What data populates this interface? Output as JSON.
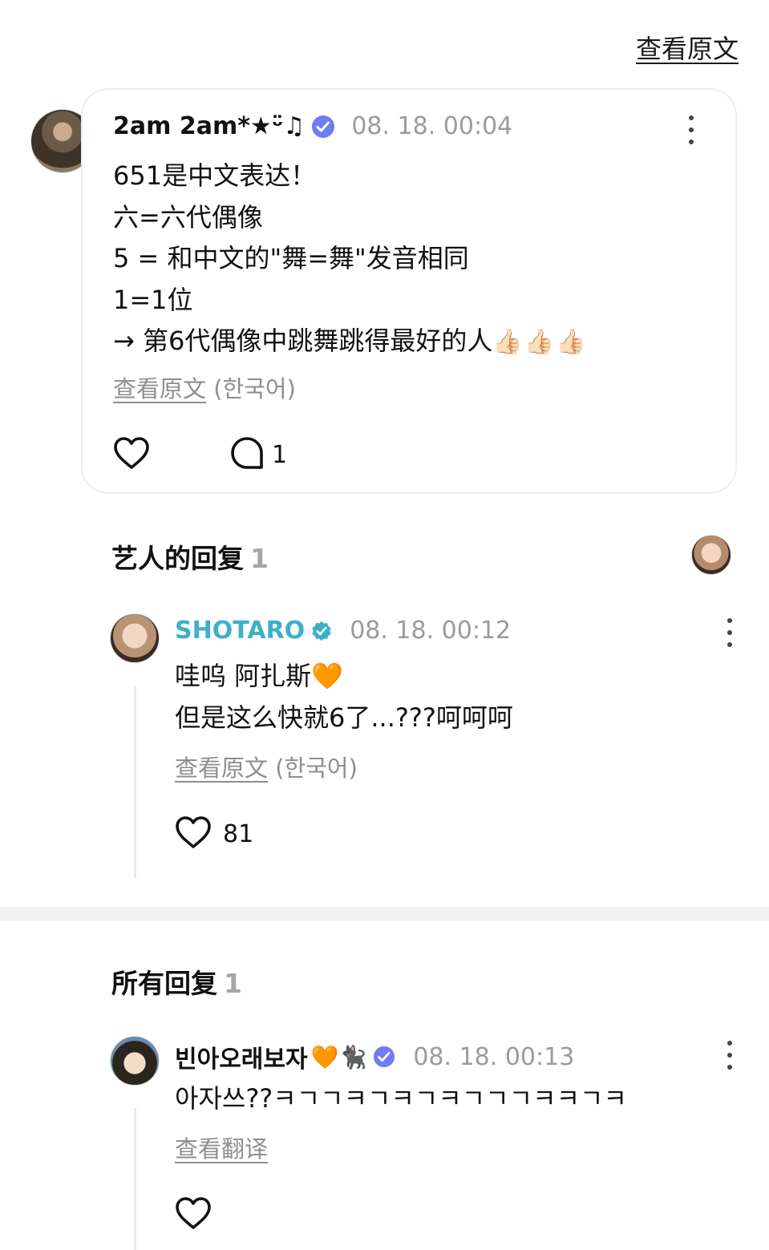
{
  "header": {
    "view_original": "查看原文"
  },
  "post": {
    "author": "2am 2am*★ᵕ̈♫",
    "timestamp": "08. 18. 00:04",
    "lines": [
      "651是中文表达！",
      "六=六代偶像",
      "5 = 和中文的\"舞=舞\"发音相同",
      "1=1位",
      "→ 第6代偶像中跳舞跳得最好的人"
    ],
    "line5_emoji": "👍🏻👍🏻👍🏻",
    "view_original_label": "查看原文",
    "original_language": "(한국어)",
    "reply_count": "1"
  },
  "artist_replies": {
    "title": "艺人的回复",
    "count": "1",
    "items": [
      {
        "author": "SHOTARO",
        "author_color": "#3db0c8",
        "timestamp": "08. 18. 00:12",
        "line1": "哇呜 阿扎斯",
        "line1_emoji": "🧡",
        "line2": "但是这么快就6了...???呵呵呵",
        "view_original_label": "查看原文",
        "original_language": "(한국어)",
        "likes": "81"
      }
    ]
  },
  "all_replies": {
    "title": "所有回复",
    "count": "1",
    "items": [
      {
        "author": "빈아오래보자",
        "author_emoji": "🧡🐈‍⬛",
        "timestamp": "08. 18. 00:13",
        "text": "아자쓰??ㅋㄱㄱㅋㄱㅋㄱㅋㄱㄱㄱㅋㅋㄱㅋ",
        "translate_label": "查看翻译"
      }
    ]
  },
  "colors": {
    "verified_badge": "#6f7cf2",
    "artist_badge": "#3db0c8",
    "muted_text": "#9b9b9b"
  },
  "icons": [
    "heart-icon",
    "comment-icon",
    "kebab-menu-icon",
    "verified-badge-icon"
  ]
}
